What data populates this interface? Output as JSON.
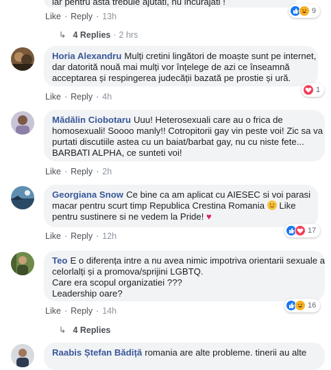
{
  "comments": [
    {
      "author": "",
      "lines": [
        "iar pentru asta trebuie ajutati, nu incurajati !"
      ],
      "like": "Like",
      "reply": "Reply",
      "time": "13h",
      "reactions": {
        "count": "9",
        "icons": [
          "like",
          "haha"
        ]
      },
      "replies": {
        "label": "4 Replies",
        "time": "2 hrs"
      }
    },
    {
      "author": "Horia Alexandru",
      "lines": [
        "Mulți cretini lingători de moaște sunt pe internet,",
        "dar datorită nouă mai mulți vor înțelege de azi ce înseamnă",
        "acceptarea și respingerea judecății bazată pe prostie și ură."
      ],
      "like": "Like",
      "reply": "Reply",
      "time": "4h",
      "reactions": {
        "count": "1",
        "icons": [
          "love"
        ]
      }
    },
    {
      "author": "Mădălin Ciobotaru",
      "lines": [
        "Uuu! Heterosexuali care au o frica de",
        "homosexuali! Soooo manly!! Cotropitorii gay vin peste voi! Zic sa va",
        "purtati discutiile astea cu un baiat/barbat gay, nu cu niste fete...",
        "BARBATI ALPHA, ce sunteti voi!"
      ],
      "like": "Like",
      "reply": "Reply",
      "time": "2h"
    },
    {
      "author": "Georgiana Snow",
      "lines": [
        "Ce bine ca am aplicat cu AIESEC si voi parasi",
        "macar pentru scurt timp Republica Crestina Romania",
        "Like",
        "pentru sustinere si ne vedem la Pride!"
      ],
      "like": "Like",
      "reply": "Reply",
      "time": "12h",
      "reactions": {
        "count": "17",
        "icons": [
          "like",
          "love"
        ]
      }
    },
    {
      "author": "Teo",
      "lines": [
        "E o diferența intre a nu avea nimic impotriva orientarii sexuale a",
        "celorlalți și a promova/sprijini LGBTQ.",
        "Care era scopul organizatiei ???",
        "Leadership oare?"
      ],
      "like": "Like",
      "reply": "Reply",
      "time": "14h",
      "reactions": {
        "count": "16",
        "icons": [
          "like",
          "haha"
        ]
      },
      "replies": {
        "label": "4 Replies"
      }
    },
    {
      "author": "Raabis Ștefan Bădiță",
      "lines": [
        "romania are alte probleme. tinerii au alte"
      ]
    }
  ],
  "icons": {
    "reply_arrow": "reply-arrow-icon",
    "like": "like-reaction-icon",
    "love": "love-reaction-icon",
    "haha": "haha-reaction-icon"
  },
  "colors": {
    "name": "#385898",
    "bubble": "#f2f3f5",
    "like": "#1877f2",
    "love": "#f33e58",
    "haha": "#f7b125"
  }
}
